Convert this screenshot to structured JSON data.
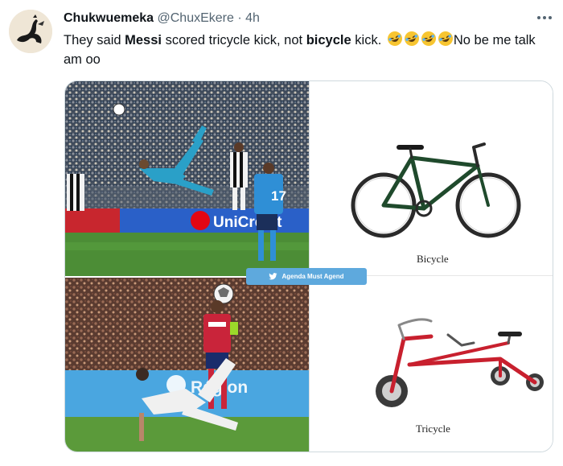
{
  "tweet": {
    "display_name": "Chukwuemeka",
    "handle": "@ChuxEkere",
    "separator": "·",
    "time": "4h",
    "text_parts": {
      "p1": "They said ",
      "p2": "Messi",
      "p3": " scored tricycle kick, not ",
      "p4": "bicycle",
      "p5": " kick. ",
      "p6": "No be me talk am oo"
    },
    "emoji": [
      "rolling-on-floor-laughing",
      "rolling-on-floor-laughing",
      "rolling-on-floor-laughing",
      "rolling-on-floor-laughing"
    ]
  },
  "media": {
    "banner_text_top": "UniCredit",
    "jersey_number": "17",
    "banner_text_bottom": "Région",
    "caption_bicycle": "Bicycle",
    "caption_tricycle": "Tricycle",
    "watermark": "Agenda Must Agend"
  },
  "colors": {
    "accent": "#1d9bf0",
    "text": "#0f1419",
    "muted": "#536471"
  }
}
